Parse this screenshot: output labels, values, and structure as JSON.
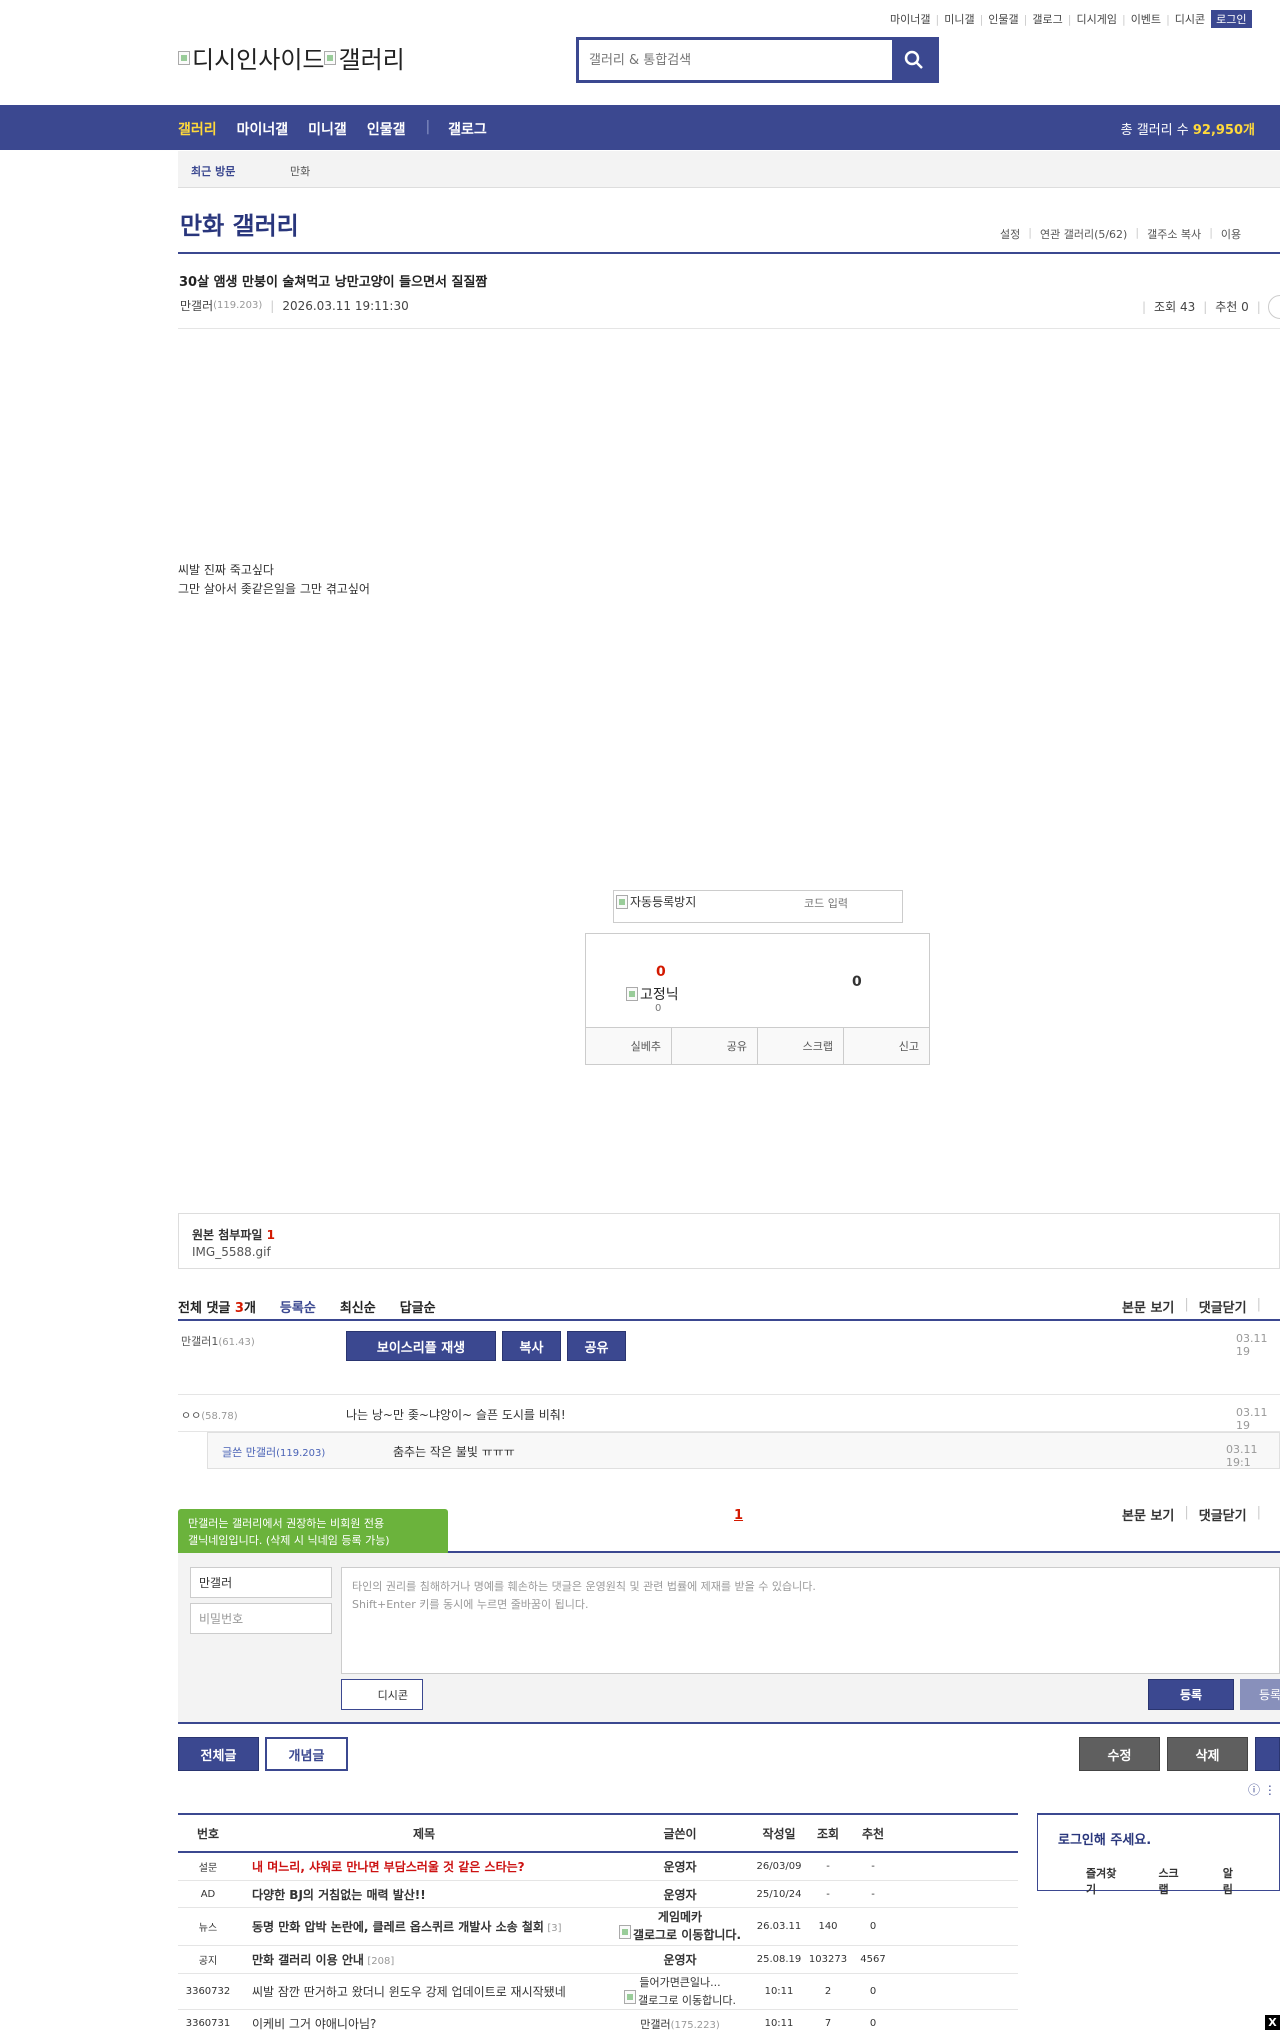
{
  "top_links": [
    "마이너갤",
    "미니갤",
    "인물갤",
    "갤로그",
    "디시게임",
    "이벤트",
    "디시콘"
  ],
  "login_label": "로그인",
  "logo": {
    "part1": "디시인사이드",
    "part2": "갤러리"
  },
  "search": {
    "placeholder": "갤러리 & 통합검색"
  },
  "gnb": {
    "items": [
      "갤러리",
      "마이너갤",
      "미니갤",
      "인물갤",
      "갤로그"
    ],
    "total_label": "총 갤러리 수",
    "total_value": "92,950개"
  },
  "recent": {
    "label": "최근 방문",
    "item": "만화"
  },
  "gallery": {
    "title": "만화 갤러리",
    "menu": [
      "설정",
      "연관 갤러리(5/62)",
      "갤주소 복사",
      "이용"
    ]
  },
  "post": {
    "title": "30살 앰생 만붕이 술쳐먹고 낭만고양이 들으면서 질질짬",
    "author": "만갤러",
    "author_ip": "(119.203)",
    "date": "2026.03.11 19:11:30",
    "views_label": "조회 43",
    "rec_label": "추천 0",
    "body_lines": [
      "씨발 진짜 죽고싶다",
      "그만 살아서 좆같은일을 그만 겪고싶어"
    ]
  },
  "captcha": {
    "alt": "자동등록방지",
    "placeholder": "코드 입력"
  },
  "recommend": {
    "up_count": "0",
    "fixed_alt": "고정닉",
    "fixed_count": "0",
    "down_count": "0",
    "buttons": [
      "실베추",
      "공유",
      "스크랩",
      "신고"
    ]
  },
  "attachment": {
    "label": "원본 첨부파일",
    "count": "1",
    "file": "IMG_5588.gif"
  },
  "comments_header": {
    "label": "전체 댓글",
    "count": "3",
    "unit": "개",
    "tabs": [
      "등록순",
      "최신순",
      "답글순"
    ],
    "right": [
      "본문 보기",
      "댓글닫기"
    ]
  },
  "comments": [
    {
      "nick": "만갤러1",
      "ip": "(61.43)",
      "date": "03.11 19",
      "voice_buttons": [
        "보이스리플 재생",
        "복사",
        "공유"
      ]
    },
    {
      "nick": "ㅇㅇ",
      "ip": "(58.78)",
      "date": "03.11 19",
      "text": "나는 낭~만 좆~냐앙이~ 슬픈 도시를 비춰!"
    }
  ],
  "reply": {
    "nick": "글쓴 만갤러",
    "ip": "(119.203)",
    "text": "춤추는 작은 불빛 ㅠㅠㅠ",
    "date": "03.11 19:1"
  },
  "pager": {
    "current": "1"
  },
  "comments_footer": [
    "본문 보기",
    "댓글닫기"
  ],
  "tooltip": {
    "line1": "만갤러는 갤러리에서 권장하는 비회원 전용",
    "line2": "갤닉네임입니다. (삭제 시 닉네임 등록 가능)"
  },
  "write": {
    "nick_value": "만갤러",
    "password_placeholder": "비밀번호",
    "notice_line1": "타인의 권리를 침해하거나 명예를 훼손하는 댓글은 운영원칙 및 관련 법률에 제재를 받을 수 있습니다.",
    "notice_line2": "Shift+Enter 키를 동시에 누르면 줄바꿈이 됩니다.",
    "dccon_label": "디시콘",
    "register_label": "등록",
    "register2_label": "등록"
  },
  "list_buttons": {
    "all": "전체글",
    "concept": "개념글",
    "edit": "수정",
    "delete": "삭제"
  },
  "table": {
    "headers": [
      "번호",
      "제목",
      "글쓴이",
      "작성일",
      "조회",
      "추천"
    ],
    "rows": [
      {
        "num": "설문",
        "title": "내 며느리, 샤워로 만나면 부담스러울 것 같은 스타는?",
        "writer": "운영자",
        "date": "26/03/09",
        "views": "-",
        "rec": "-"
      },
      {
        "num": "AD",
        "title": "다양한 BJ의 거침없는 매력 발산!!",
        "writer": "운영자",
        "date": "25/10/24",
        "views": "-",
        "rec": "-"
      },
      {
        "num": "뉴스",
        "title": "동명 만화 압박 논란에, 클레르 옵스퀴르 개발사 소송 철회",
        "reply": "[3]",
        "writer_top": "게임메카",
        "writer_bottom": "갤로그로 이동합니다.",
        "date": "26.03.11",
        "views": "140",
        "rec": "0"
      },
      {
        "num": "공지",
        "title": "만화 갤러리 이용 안내",
        "reply": "[208]",
        "writer": "운영자",
        "date": "25.08.19",
        "views": "103273",
        "rec": "4567"
      },
      {
        "num": "3360732",
        "title": "씨발 잠깐 딴거하고 왔더니 윈도우 강제 업데이트로 재시작됐네",
        "writer_top": "들어가면큰일나...",
        "writer_bottom": "갤로그로 이동합니다.",
        "date": "10:11",
        "views": "2",
        "rec": "0"
      },
      {
        "num": "3360731",
        "title": "이케비 그거 야애니아님?",
        "writer": "만갤러",
        "writer_ip": "(175.223)",
        "date": "10:11",
        "views": "7",
        "rec": "0"
      }
    ]
  },
  "side": {
    "title": "로그인해 주세요.",
    "links": [
      "즐겨찾기",
      "스크랩",
      "알림"
    ]
  },
  "corner_close": "X"
}
